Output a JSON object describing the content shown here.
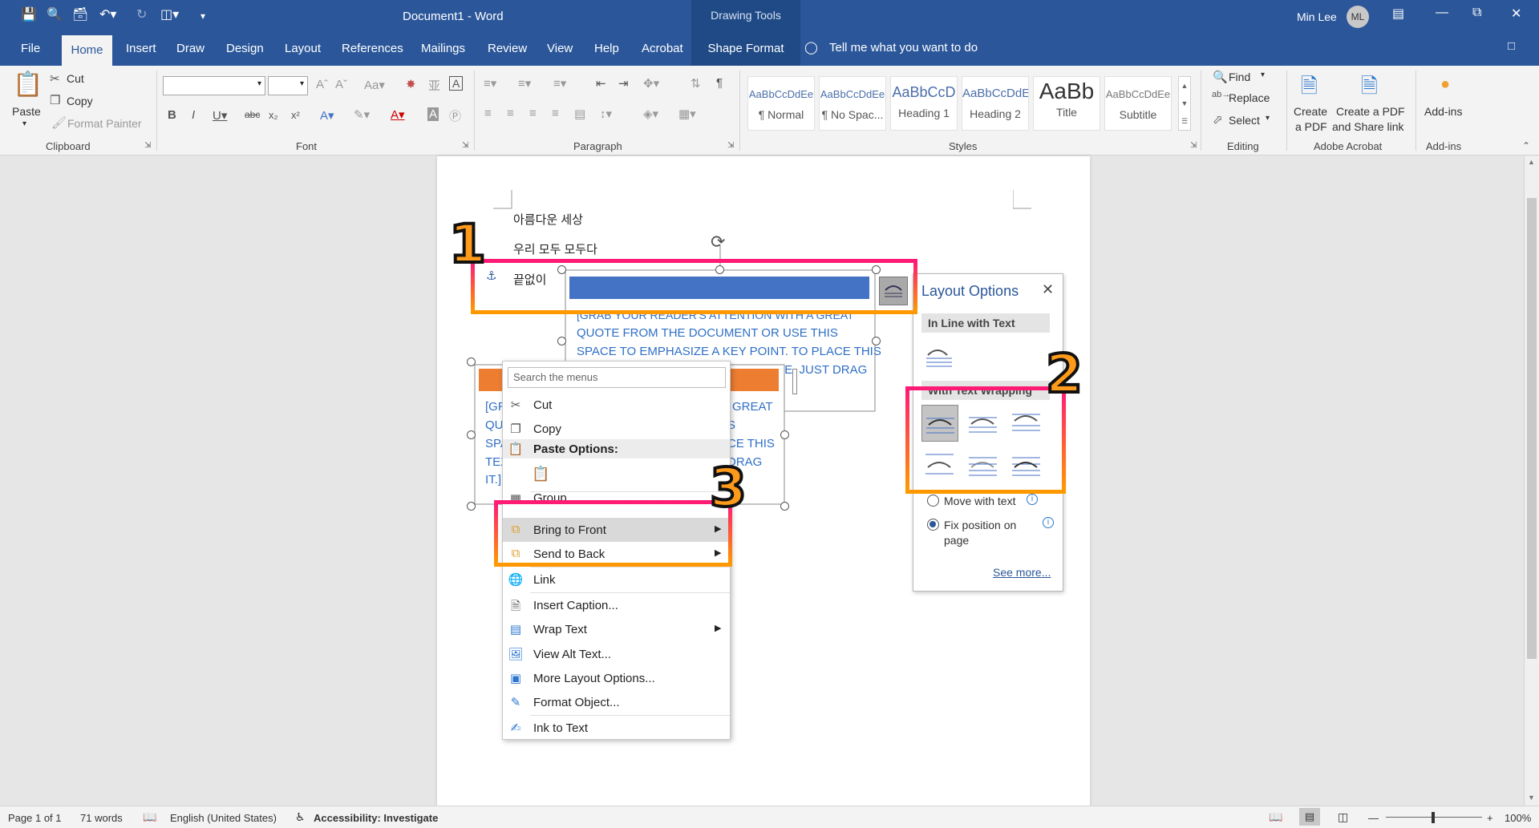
{
  "title_bar": {
    "doc_title": "Document1  -  Word",
    "context_tool": "Drawing Tools",
    "user_name": "Min Lee",
    "user_initials": "ML"
  },
  "tabs": [
    {
      "label": "File"
    },
    {
      "label": "Home"
    },
    {
      "label": "Insert"
    },
    {
      "label": "Draw"
    },
    {
      "label": "Design"
    },
    {
      "label": "Layout"
    },
    {
      "label": "References"
    },
    {
      "label": "Mailings"
    },
    {
      "label": "Review"
    },
    {
      "label": "View"
    },
    {
      "label": "Help"
    },
    {
      "label": "Acrobat"
    },
    {
      "label": "Shape Format"
    }
  ],
  "tell_me": "Tell me what you want to do",
  "ribbon": {
    "clipboard": {
      "paste": "Paste",
      "cut": "Cut",
      "copy": "Copy",
      "format_painter": "Format Painter",
      "label": "Clipboard"
    },
    "font": {
      "label": "Font"
    },
    "paragraph": {
      "label": "Paragraph"
    },
    "styles": {
      "label": "Styles",
      "items": [
        {
          "sample": "AaBbCcDdEe",
          "name": "¶ Normal"
        },
        {
          "sample": "AaBbCcDdEe",
          "name": "¶ No Spac..."
        },
        {
          "sample": "AaBbCcD",
          "name": "Heading 1"
        },
        {
          "sample": "AaBbCcDdE",
          "name": "Heading 2"
        },
        {
          "sample": "AaBb",
          "name": "Title"
        },
        {
          "sample": "AaBbCcDdEe",
          "name": "Subtitle"
        }
      ]
    },
    "editing": {
      "find": "Find",
      "replace": "Replace",
      "select": "Select",
      "label": "Editing"
    },
    "acrobat": {
      "create_pdf_1": "Create",
      "create_pdf_2": "a PDF",
      "share_1": "Create a PDF",
      "share_2": "and Share link",
      "label": "Adobe Acrobat"
    },
    "addins": {
      "addins": "Add-ins",
      "label": "Add-ins"
    }
  },
  "document": {
    "lines": [
      "아름다운 세상",
      "우리 모두 모두다",
      "끝없이"
    ],
    "shape1_lines": [
      "[GRAB YOUR READER'S ATTENTION WITH A GREAT",
      "QUOTE FROM THE DOCUMENT OR USE THIS",
      "SPACE TO EMPHASIZE A KEY POINT. TO PLACE THIS",
      "TEXT BOX ANYWHERE ON THE PAGE, JUST DRAG"
    ],
    "shape2_left": [
      "[GR",
      "QU",
      "SPA",
      "TEX",
      "IT.]"
    ],
    "shape2_right": [
      "GREAT",
      "S",
      "CE THIS",
      "DRAG"
    ]
  },
  "layout_options": {
    "title": "Layout Options",
    "inline_heading": "In Line with Text",
    "wrap_heading": "With Text Wrapping",
    "move_with_text": "Move with text",
    "fix_position_1": "Fix position on",
    "fix_position_2": "page",
    "see_more": "See more..."
  },
  "context_menu": {
    "search_placeholder": "Search the menus",
    "cut": "Cut",
    "copy": "Copy",
    "paste_options": "Paste Options:",
    "group": "Group",
    "bring_to_front": "Bring to Front",
    "send_to_back": "Send to Back",
    "link": "Link",
    "insert_caption": "Insert Caption...",
    "wrap_text": "Wrap Text",
    "view_alt_text": "View Alt Text...",
    "more_layout": "More Layout Options...",
    "format_object": "Format Object...",
    "ink_to_text": "Ink to Text"
  },
  "annotations": [
    "1",
    "2",
    "3"
  ],
  "status_bar": {
    "page": "Page 1 of 1",
    "words": "71 words",
    "language": "English (United States)",
    "accessibility": "Accessibility: Investigate",
    "zoom": "100%"
  },
  "colors": {
    "brand": "#2b579a",
    "annotation_pink": "#ff1a75",
    "annotation_orange": "#ff9900",
    "shape_blue": "#4472c4",
    "shape_orange": "#ed7d31"
  }
}
